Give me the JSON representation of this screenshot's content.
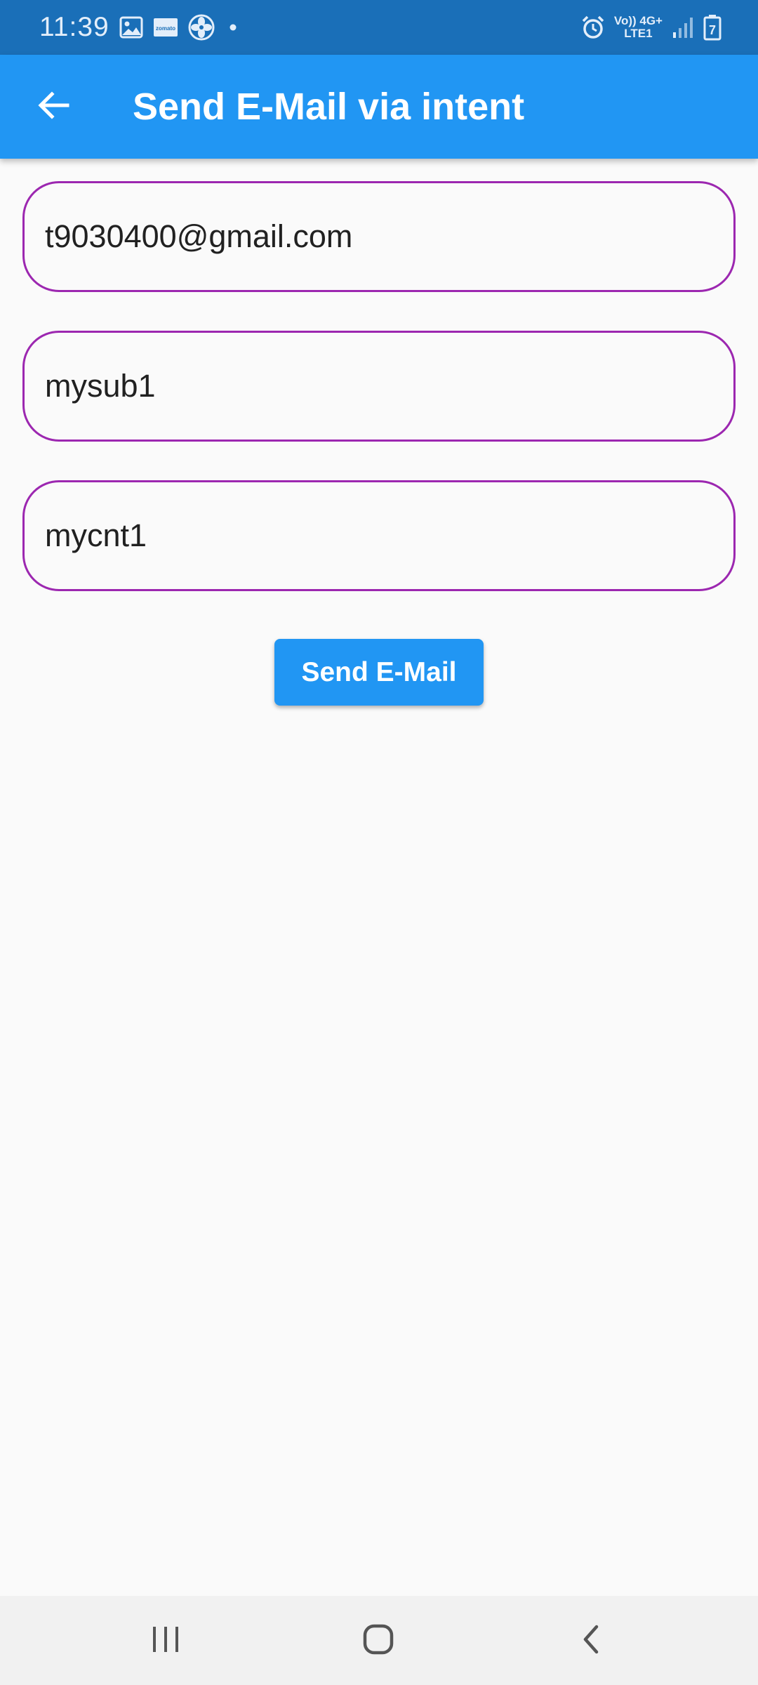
{
  "status_bar": {
    "time": "11:39",
    "network_top": "Vo)) 4G+",
    "network_bottom": "LTE1",
    "battery_level": "7",
    "icons": [
      "gallery-icon",
      "zomato-icon",
      "fan-icon",
      "dot-icon",
      "alarm-icon",
      "signal-icon",
      "battery-icon"
    ],
    "zomato_text": "zomato"
  },
  "app_bar": {
    "title": "Send E-Mail via intent",
    "color": "#2196f3"
  },
  "form": {
    "email_value": "t9030400@gmail.com",
    "subject_value": "mysub1",
    "content_value": "mycnt1",
    "border_color": "#9c27b0"
  },
  "send_button": {
    "label": "Send E-Mail",
    "color": "#2196f3"
  },
  "nav_bar": {
    "icons": [
      "recents-icon",
      "home-icon",
      "back-icon"
    ]
  }
}
